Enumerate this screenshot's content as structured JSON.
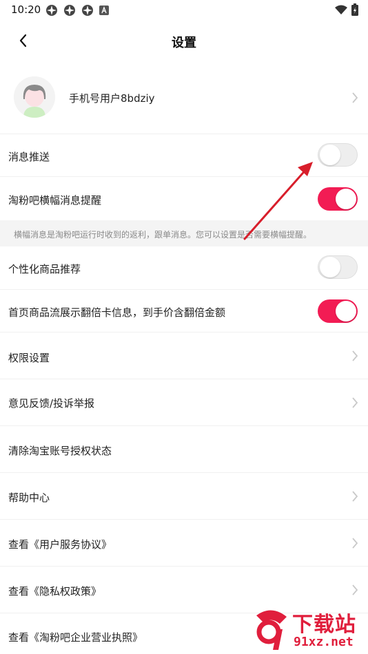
{
  "status_bar": {
    "time": "10:20",
    "left_icons": [
      "app-notification-icon",
      "app-notification-icon",
      "app-notification-icon",
      "a-icon"
    ],
    "right_icons": [
      "wifi-icon",
      "battery-charging-icon"
    ]
  },
  "header": {
    "back_icon": "chevron-left-icon",
    "title": "设置"
  },
  "profile": {
    "name": "手机号用户8bdziy",
    "avatar": "avatar"
  },
  "rows": [
    {
      "label": "消息推送",
      "type": "toggle",
      "value": false
    },
    {
      "label": "淘粉吧横幅消息提醒",
      "type": "toggle",
      "value": true
    },
    {
      "label": "个性化商品推荐",
      "type": "toggle",
      "value": false
    },
    {
      "label": "首页商品流展示翻倍卡信息，到手价含翻倍金额",
      "type": "toggle",
      "value": true
    },
    {
      "label": "权限设置",
      "type": "link"
    },
    {
      "label": "意见反馈/投诉举报",
      "type": "link"
    },
    {
      "label": "清除淘宝账号授权状态",
      "type": "action"
    },
    {
      "label": "帮助中心",
      "type": "link"
    },
    {
      "label": "查看《用户服务协议》",
      "type": "link"
    },
    {
      "label": "查看《隐私权政策》",
      "type": "link"
    },
    {
      "label": "查看《淘粉吧企业营业执照》",
      "type": "link"
    }
  ],
  "note": "横幅消息是淘粉吧运行时收到的返利，跟单消息。您可以设置是否需要横幅提醒。",
  "colors": {
    "toggle_on": "#f21c54",
    "toggle_off": "#eeeeee",
    "annotation_arrow": "#d81e2b"
  },
  "watermark": {
    "top": "下载站",
    "bottom": "91xz.net"
  }
}
